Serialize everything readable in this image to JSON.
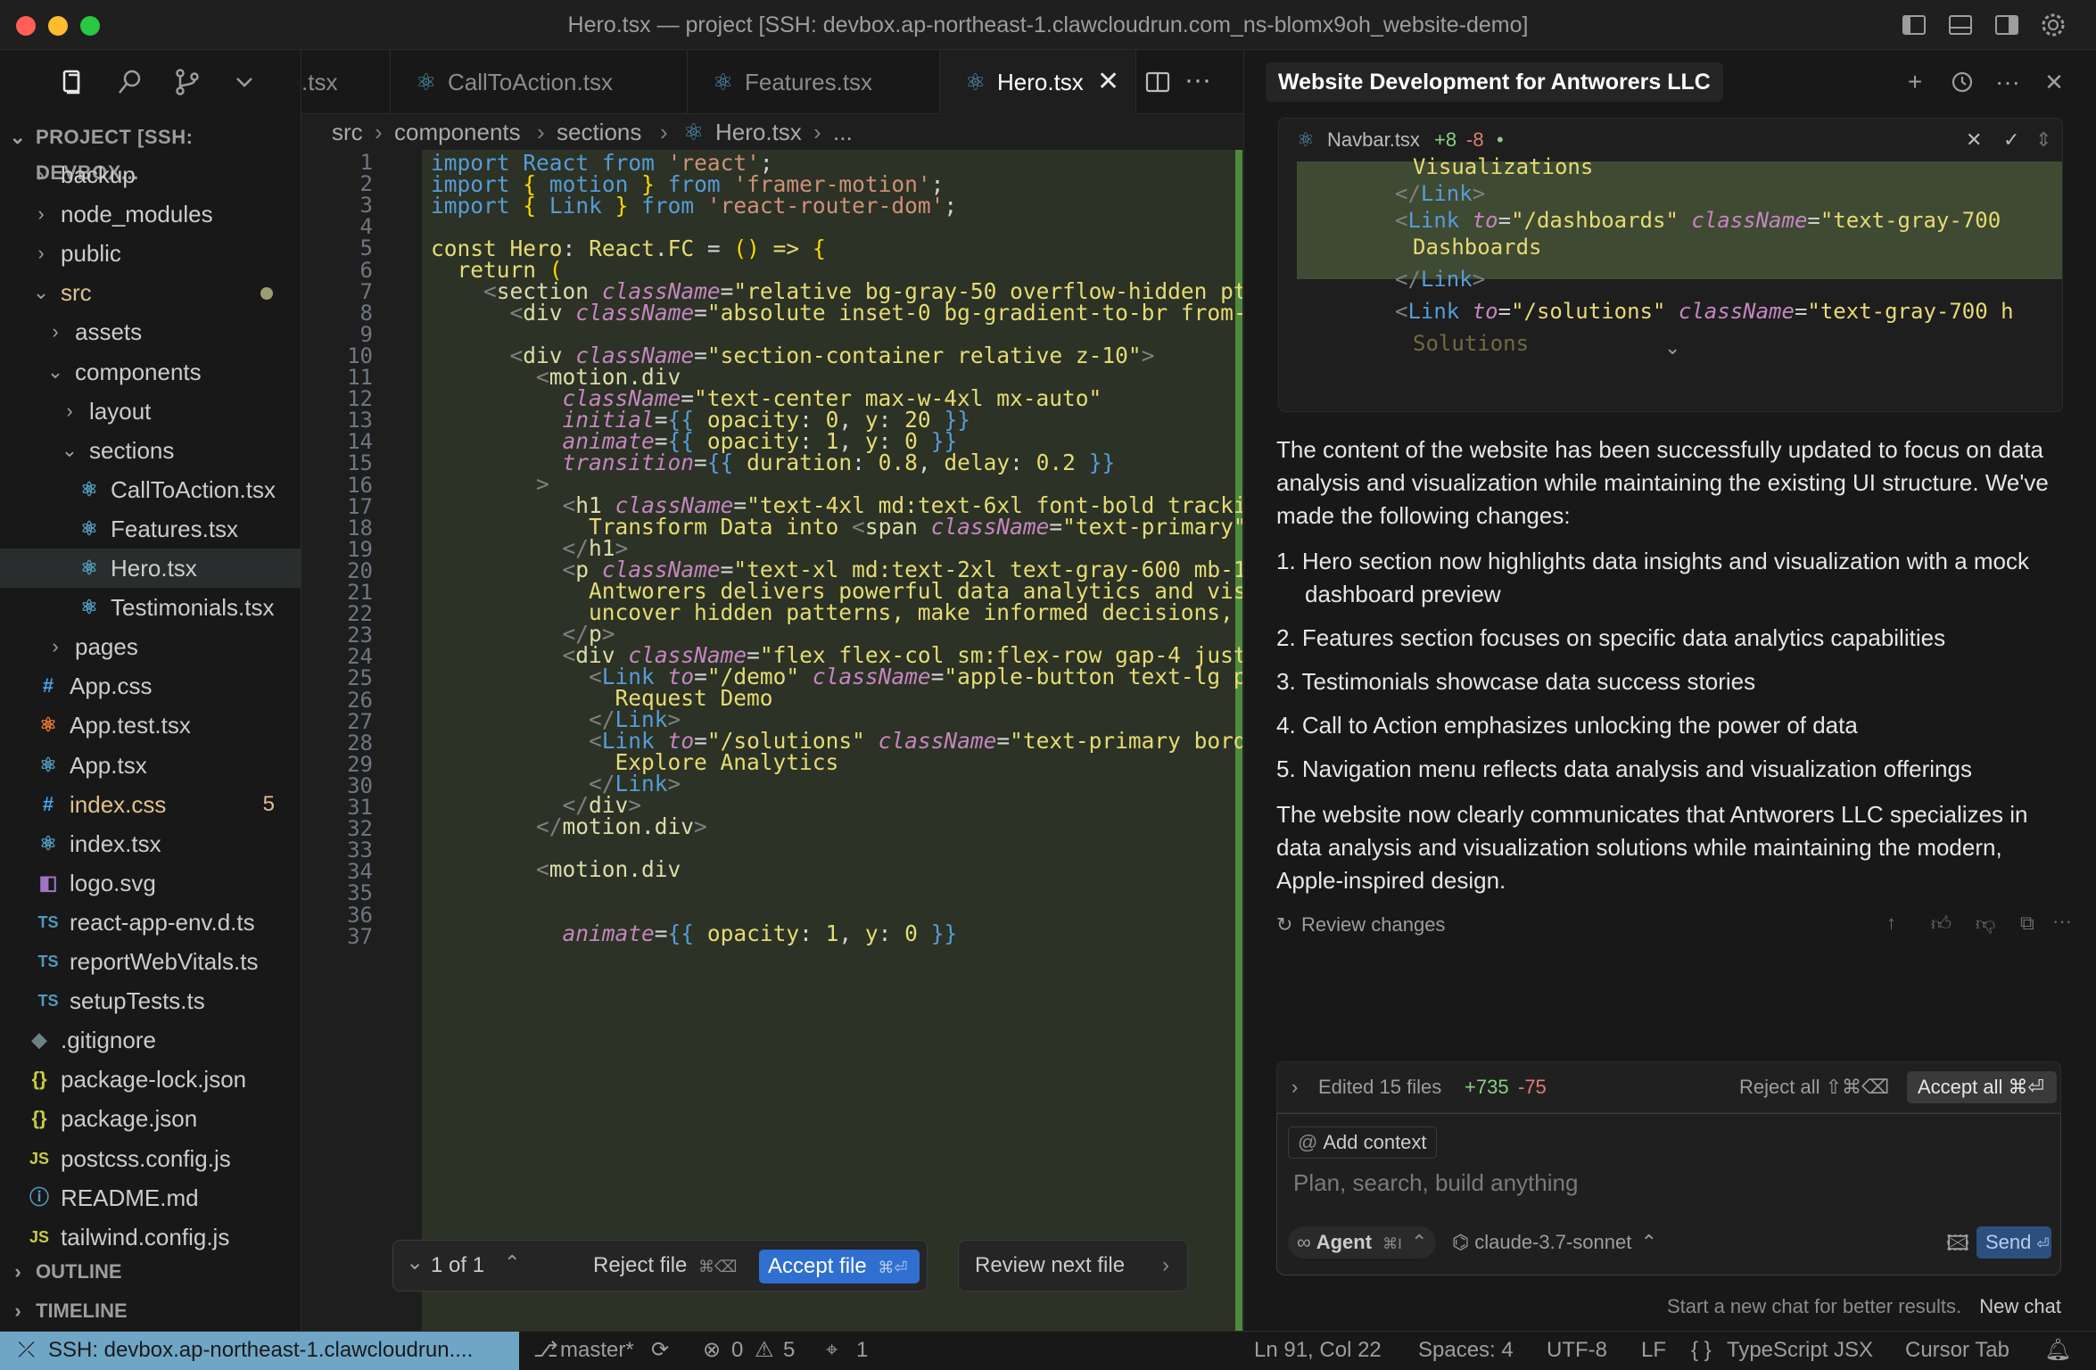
{
  "window": {
    "title": "Hero.tsx — project [SSH: devbox.ap-northeast-1.clawcloudrun.com_ns-blomx9oh_website-demo]"
  },
  "explorer": {
    "header": "PROJECT [SSH: DEVBOX...",
    "items": [
      {
        "label": "backup",
        "type": "folder"
      },
      {
        "label": "node_modules",
        "type": "folder"
      },
      {
        "label": "public",
        "type": "folder"
      },
      {
        "label": "src",
        "type": "folder-open"
      },
      {
        "label": "assets",
        "type": "folder"
      },
      {
        "label": "components",
        "type": "folder-open"
      },
      {
        "label": "layout",
        "type": "folder"
      },
      {
        "label": "sections",
        "type": "folder-open"
      },
      {
        "label": "CallToAction.tsx",
        "type": "react"
      },
      {
        "label": "Features.tsx",
        "type": "react"
      },
      {
        "label": "Hero.tsx",
        "type": "react"
      },
      {
        "label": "Testimonials.tsx",
        "type": "react"
      },
      {
        "label": "pages",
        "type": "folder"
      },
      {
        "label": "App.css",
        "type": "css"
      },
      {
        "label": "App.test.tsx",
        "type": "react-test"
      },
      {
        "label": "App.tsx",
        "type": "react"
      },
      {
        "label": "index.css",
        "type": "css"
      },
      {
        "label": "index.tsx",
        "type": "react"
      },
      {
        "label": "logo.svg",
        "type": "svg"
      },
      {
        "label": "react-app-env.d.ts",
        "type": "ts"
      },
      {
        "label": "reportWebVitals.ts",
        "type": "ts"
      },
      {
        "label": "setupTests.ts",
        "type": "ts"
      },
      {
        "label": ".gitignore",
        "type": "git"
      },
      {
        "label": "package-lock.json",
        "type": "json"
      },
      {
        "label": "package.json",
        "type": "json"
      },
      {
        "label": "postcss.config.js",
        "type": "js"
      },
      {
        "label": "README.md",
        "type": "info"
      },
      {
        "label": "tailwind.config.js",
        "type": "js"
      }
    ],
    "index_css_badge": "5",
    "outline": "OUTLINE",
    "timeline": "TIMELINE"
  },
  "tabs": [
    {
      "label": ".tsx"
    },
    {
      "label": "CallToAction.tsx"
    },
    {
      "label": "Features.tsx"
    },
    {
      "label": "Hero.tsx",
      "active": true
    }
  ],
  "breadcrumb": [
    "src",
    "components",
    "sections",
    "Hero.tsx",
    "..."
  ],
  "code": {
    "line_numbers": [
      "1",
      "2",
      "3",
      "4",
      "5",
      "6",
      "7",
      "8",
      "9",
      "10",
      "11",
      "12",
      "13",
      "14",
      "15",
      "16",
      "17",
      "18",
      "19",
      "20",
      "21",
      "22",
      "23",
      "24",
      "25",
      "26",
      "27",
      "28",
      "29",
      "30",
      "31",
      "32",
      "33",
      "34",
      "35",
      "36",
      "37"
    ]
  },
  "review_bar": {
    "counter": "1 of 1",
    "reject_file": "Reject file",
    "reject_shortcut": "⌘⌫",
    "accept_file": "Accept file",
    "accept_shortcut": "⌘⏎",
    "review_next": "Review next file"
  },
  "chat": {
    "title": "Website Development for Antworers LLC",
    "diff_file": "Navbar.tsx",
    "diff_added": "+8",
    "diff_removed": "-8",
    "intro": "The content of the website has been successfully updated to focus on data analysis and visualization while maintaining the existing UI structure. We've made the following changes:",
    "changes": [
      "1. Hero section now highlights data insights and visualization with a mock dashboard preview",
      "2. Features section focuses on specific data analytics capabilities",
      "3. Testimonials showcase data success stories",
      "4. Call to Action emphasizes unlocking the power of data",
      "5. Navigation menu reflects data analysis and visualization offerings"
    ],
    "conclusion": "The website now clearly communicates that Antworers LLC specializes in data analysis and visualization solutions while maintaining the modern, Apple-inspired design.",
    "review_changes": "Review changes",
    "edited_summary": "Edited 15 files",
    "edited_added": "+735",
    "edited_removed": "-75",
    "reject_all": "Reject all ⇧⌘⌫",
    "accept_all": "Accept all ⌘⏎",
    "add_context": "Add context",
    "input_placeholder": "Plan, search, build anything",
    "agent_label": "Agent",
    "agent_shortcut": "⌘I",
    "model": "claude-3.7-sonnet",
    "send": "Send",
    "new_chat_hint": "Start a new chat for better results.",
    "new_chat": "New chat"
  },
  "statusbar": {
    "remote": "SSH: devbox.ap-northeast-1.clawcloudrun....",
    "branch": "master*",
    "errors": "0",
    "warnings": "5",
    "ports": "1",
    "position": "Ln 91, Col 22",
    "spaces": "Spaces: 4",
    "encoding": "UTF-8",
    "eol": "LF",
    "language": "TypeScript JSX",
    "cursor_tab": "Cursor Tab"
  },
  "colors": {
    "accent_blue": "#2f6fcf",
    "remote_bg": "#6fa6c6",
    "added_green": "#89d185",
    "removed_red": "#e07e6e",
    "diff_added_bg": "#2c3225"
  }
}
